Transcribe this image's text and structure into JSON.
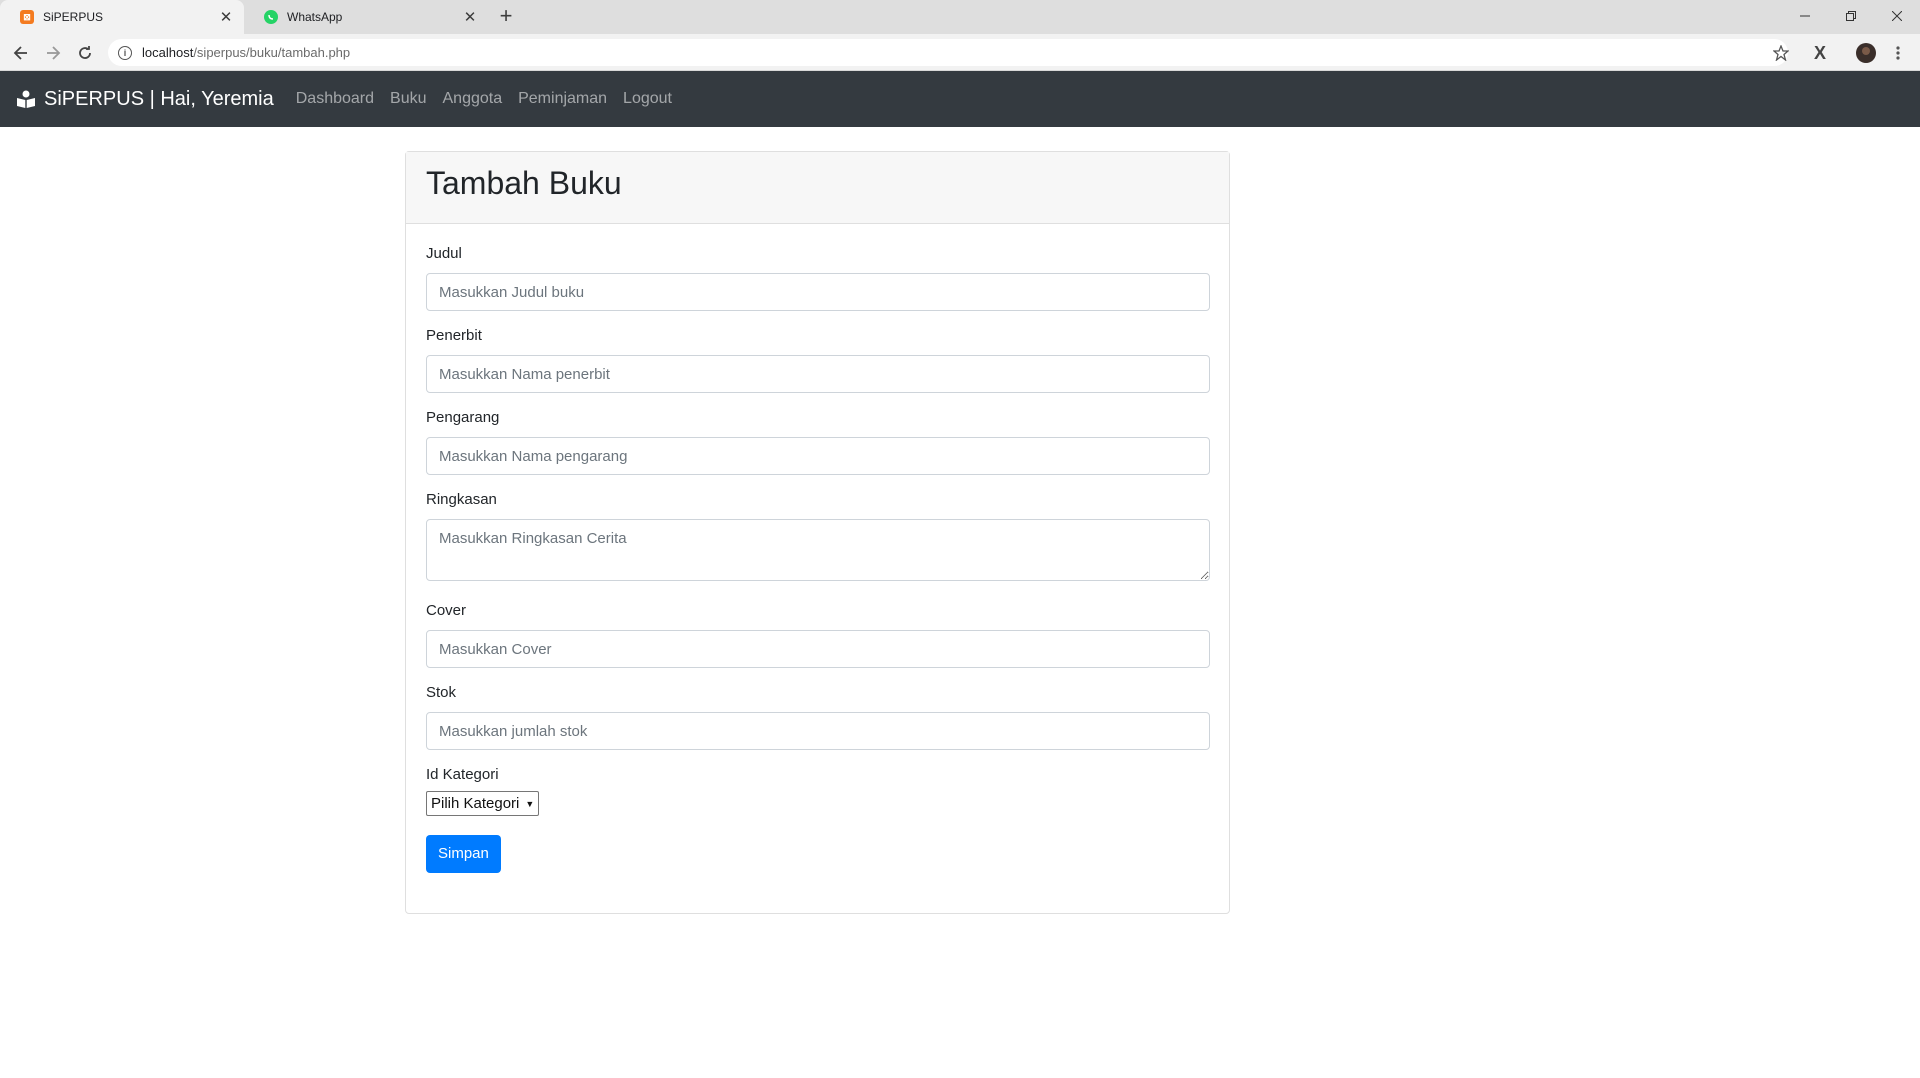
{
  "browser": {
    "tabs": [
      {
        "title": "SiPERPUS",
        "active": true,
        "favicon_color": "#f47b20",
        "favicon_glyph": "XS"
      },
      {
        "title": "WhatsApp",
        "active": false,
        "favicon_color": "#25d366",
        "favicon_glyph": ""
      }
    ],
    "url_host": "localhost",
    "url_path": "/siperpus/buku/tambah.php"
  },
  "navbar": {
    "brand": "SiPERPUS | Hai, Yeremia",
    "links": [
      "Dashboard",
      "Buku",
      "Anggota",
      "Peminjaman",
      "Logout"
    ]
  },
  "form": {
    "title": "Tambah Buku",
    "fields": {
      "judul": {
        "label": "Judul",
        "placeholder": "Masukkan Judul buku"
      },
      "penerbit": {
        "label": "Penerbit",
        "placeholder": "Masukkan Nama penerbit"
      },
      "pengarang": {
        "label": "Pengarang",
        "placeholder": "Masukkan Nama pengarang"
      },
      "ringkasan": {
        "label": "Ringkasan",
        "placeholder": "Masukkan Ringkasan Cerita"
      },
      "cover": {
        "label": "Cover",
        "placeholder": "Masukkan Cover"
      },
      "stok": {
        "label": "Stok",
        "placeholder": "Masukkan jumlah stok"
      },
      "kategori": {
        "label": "Id Kategori",
        "selected": "Pilih Kategori"
      }
    },
    "submit_label": "Simpan"
  },
  "colors": {
    "navbar_bg": "#343a40",
    "primary": "#007bff"
  }
}
